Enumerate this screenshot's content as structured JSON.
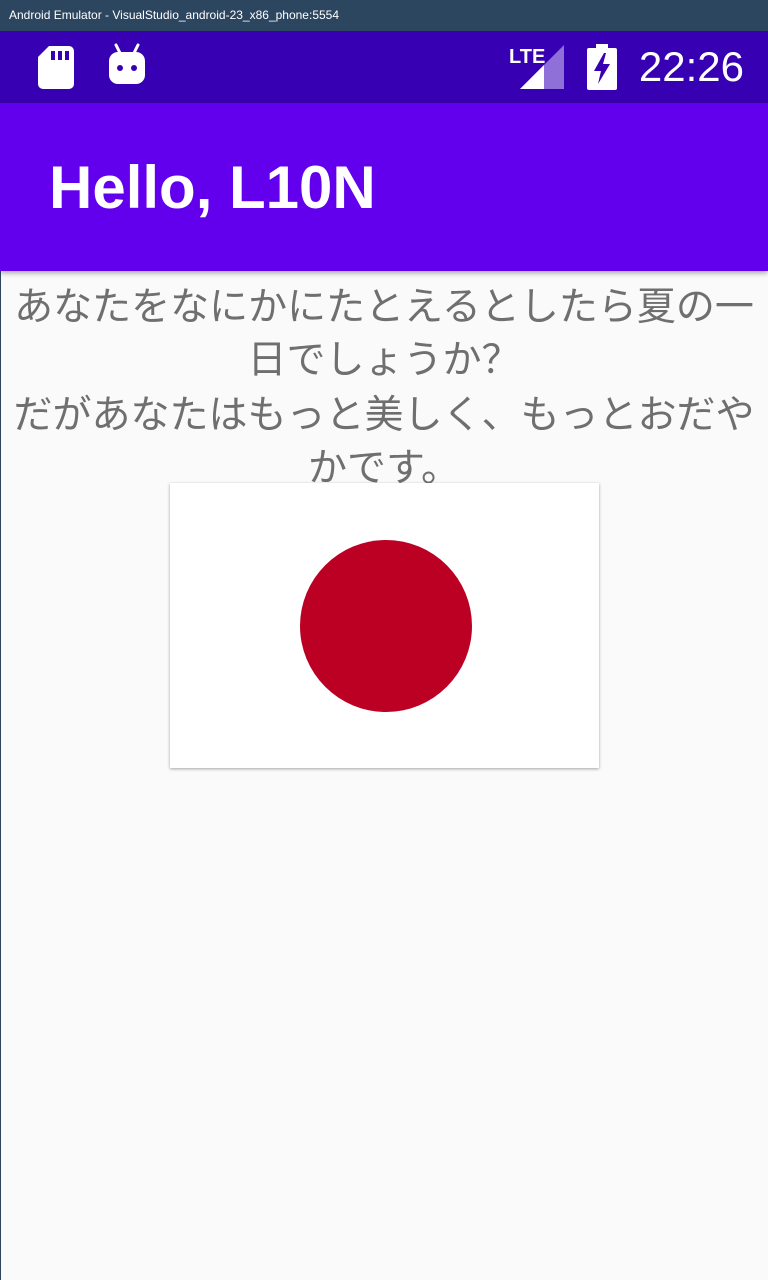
{
  "window": {
    "title": "Android Emulator - VisualStudio_android-23_x86_phone:5554"
  },
  "status_bar": {
    "left_icons": [
      "sd-card-icon",
      "android-icon"
    ],
    "right_icons": [
      "lte-signal-icon",
      "battery-charging-icon"
    ],
    "time": "22:26"
  },
  "app_bar": {
    "title": "Hello, L10N"
  },
  "content": {
    "paragraphs": [
      "あなたをなにかにたとえるとしたら夏の一日でしょうか？",
      "だがあなたはもっと美しく、もっとおだやかです。"
    ],
    "flag_image": "japan-flag-image"
  },
  "colors": {
    "status_bar": "#3700b3",
    "app_bar": "#6200ee",
    "background": "#fafafa",
    "text": "#6f6f6f",
    "flag_red": "#bc0024"
  }
}
